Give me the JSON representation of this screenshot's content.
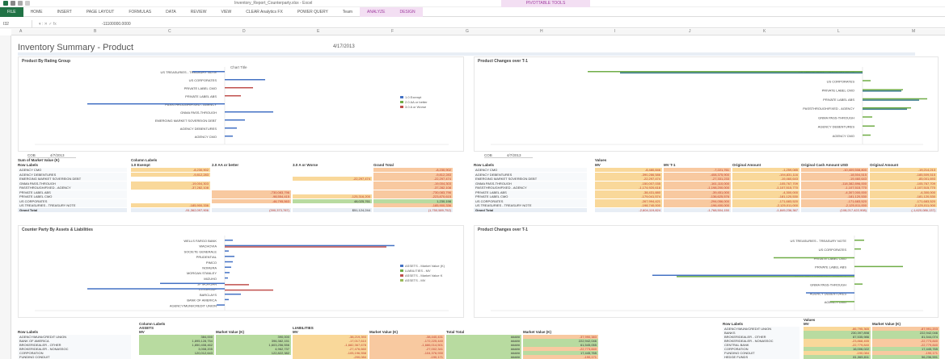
{
  "window": {
    "title": "Inventory_Report_Counterparty.xlsx - Excel",
    "context_title": "PIVOTTABLE TOOLS"
  },
  "ribbon": {
    "tabs": [
      "FILE",
      "HOME",
      "INSERT",
      "PAGE LAYOUT",
      "FORMULAS",
      "DATA",
      "REVIEW",
      "VIEW",
      "CLEAR Analytics FX",
      "POWER QUERY",
      "Team",
      "ANALYZE",
      "DESIGN"
    ],
    "context_tabs": [
      "ANALYZE",
      "DESIGN"
    ]
  },
  "formula_bar": {
    "name_box": "I32",
    "value": "-11100000.0000"
  },
  "columns": [
    "A",
    "B",
    "C",
    "D",
    "E",
    "F",
    "G",
    "H",
    "I",
    "J",
    "K",
    "L",
    "M"
  ],
  "sheet": {
    "title": "Inventory Summary - Product",
    "date": "4/17/2013"
  },
  "charts": {
    "top_left": {
      "title": "Product By Rating Group",
      "chart_title": "Chart Title",
      "categories": [
        "US TREASURIES - TREASURY NOTE",
        "US CORPORATES",
        "PRIVATE LABEL CMO",
        "PRIVATE LABEL ABS",
        "PASSTHROUGH/FIXED - AGENCY",
        "GNMA PASS-THROUGH",
        "EMERGING MARKET SOVEREIGN DEBT",
        "AGENCY DEBENTURES",
        "AGENCY CMO"
      ],
      "legend": [
        "1.0 Exempt",
        "2.0 AA or better",
        "3.0 A or Worse"
      ],
      "filter_value": "COB",
      "filter_date": "4/7/2013"
    },
    "top_right": {
      "title": "Product Changes over T-1",
      "categories": [
        "US TREASURIES - TREASURY NOTE",
        "US CORPORATES",
        "PRIVATE LABEL CMO",
        "PRIVATE LABEL ABS",
        "PASSTHROUGH/FIXED - AGENCY",
        "GNMA PASS-THROUGH",
        "AGENCY DEBENTURES",
        "AGENCY CMO"
      ],
      "filter_value": "COB",
      "filter_date": "4/7/2013"
    },
    "bottom_left": {
      "title": "Counter Party By Assets & Liabilities",
      "categories": [
        "WELLS FARGO BANK",
        "WACHOVIA",
        "SOCIETE GENERALE",
        "PRUDENTIAL",
        "PIMCO",
        "NOMURA",
        "MORGAN STANLEY",
        "MIZUHO",
        "JP MORGAN",
        "CITIGROUP",
        "BARCLAYS",
        "BANK OF AMERICA",
        "AGENCY/MUNI/CREDIT UNION"
      ],
      "legend": [
        "ASSETS - Market Value (K)",
        "LIABILITIES - MV",
        "ASSETS - Market Value K",
        "ASSETS - MV"
      ]
    },
    "bottom_right": {
      "title": "Product Changes over T-1",
      "categories": [
        "US TREASURIES - TREASURY NOTE",
        "US CORPORATES",
        "PRIVATE LABEL CMO",
        "PRIVATE LABEL ABS",
        "PASSTHROUGH/FIXED - AGENCY",
        "GNMA PASS-THROUGH",
        "AGENCY DEBENTURES",
        "AGENCY CMO"
      ]
    }
  },
  "pivot_left": {
    "header_sum": "Sum of Market Value (K)",
    "header_cols": "Column Labels",
    "row_labels": "Row Labels",
    "col_headers": [
      "1.0 Exempt",
      "2.0 AA or better",
      "3.0 A or Worse",
      "Grand Total"
    ],
    "rows": [
      {
        "label": "AGENCY CMO",
        "v": [
          "-8,230,902",
          "",
          "",
          "-8,230,902"
        ]
      },
      {
        "label": "AGENCY DEBENTURES",
        "v": [
          "-9,812,283",
          "",
          "",
          "-9,812,283"
        ]
      },
      {
        "label": "EMERGING MARKET SOVEREIGN DEBT",
        "v": [
          "",
          "",
          "-22,297,474",
          "-22,297,474"
        ]
      },
      {
        "label": "GNMA PASS-THROUGH",
        "v": [
          "-19,004,303",
          "",
          "",
          "-19,004,303"
        ]
      },
      {
        "label": "PASSTHROUGH/FIXED - AGENCY",
        "v": [
          "-37,282,108",
          "",
          "",
          "-37,282,108"
        ]
      },
      {
        "label": "PRIVATE LABEL ABS",
        "v": [
          "",
          "-730,083,796",
          "",
          "-730,083,796"
        ]
      },
      {
        "label": "PRIVATE LABEL CMO",
        "v": [
          "",
          "-98,554,415",
          "-125,316,200",
          "-223,870,615"
        ]
      },
      {
        "label": "US CORPORATES",
        "v": [
          "",
          "-46,795,563",
          "48,025,761",
          "1,230,198"
        ]
      },
      {
        "label": "US TREASURIES - TREASURY NOTE",
        "v": [
          "-185,900,336",
          "",
          "",
          "-185,900,336"
        ]
      },
      {
        "label": "Grand Total",
        "v": [
          "-91,362,097,906",
          "(390,373,787)",
          "$51,124,244",
          "(1,750,589,752)"
        ]
      }
    ]
  },
  "pivot_right": {
    "values_label": "Values",
    "row_labels": "Row Labels",
    "col_headers": [
      "MV",
      "MV T-1",
      "Original Amount",
      "Original Cash Amount USD",
      "Original Amount"
    ],
    "rows": [
      {
        "label": "AGENCY CMO",
        "v": [
          "-8,480,846",
          "-7,221,761",
          "-1,259,085",
          "-10,409,508,800",
          "-19,214,213"
        ]
      },
      {
        "label": "AGENCY DEBENTURES",
        "v": [
          "-390,286,586",
          "-408,375,900",
          "-194,831,116",
          "-18,504,515",
          "-185,509,515"
        ]
      },
      {
        "label": "EMERGING MARKET SOVEREIGN DEBT",
        "v": [
          "-22,297,474",
          "-27,331,233",
          "-19,460,643",
          "-19,460,643",
          "-85,001,693"
        ]
      },
      {
        "label": "GNMA PASS-THROUGH",
        "v": [
          "-150,007,035",
          "-161,110,000",
          "-105,767,709",
          "-118,382,896,000",
          "-105,767,709"
        ]
      },
      {
        "label": "PASSTHROUGH/FIXED - AGENCY",
        "v": [
          "-1,174,920,618",
          "-1,198,200,000",
          "-1,107,515,770",
          "-1,107,515,770",
          "-1,107,515,770"
        ]
      },
      {
        "label": "PRIVATE LABEL ABS",
        "v": [
          "-38,431,880",
          "-39,451,000",
          "-4,300,000",
          "-4,307,000,000",
          "-4,300,000"
        ]
      },
      {
        "label": "PRIVATE LABEL CMO",
        "v": [
          "-179,041,574",
          "-136,625,576",
          "-181,120,530",
          "-181,120,530",
          "-181,120,530"
        ]
      },
      {
        "label": "US CORPORATES",
        "v": [
          "-267,994,421",
          "-294,056,000",
          "-171,683,520",
          "-171,683,520",
          "-171,683,520"
        ]
      },
      {
        "label": "US TREASURIES - TREASURY NOTE",
        "v": [
          "-198,740,000",
          "-196,400,000",
          "-2,125,011,000",
          "-2,125,011,000",
          "-2,125,011,000"
        ]
      },
      {
        "label": "Grand Total",
        "v": [
          "-2,604,119,824",
          "-1,768,504,150",
          "-1,849,236,367",
          "(108,217,422,908)",
          "(-1,620,086,137)"
        ]
      }
    ]
  },
  "pivot_bottom_left": {
    "header_cols": "Column Labels",
    "row_labels": "Row Labels",
    "groups": [
      "ASSETS",
      "LIABILITIES"
    ],
    "col_headers": [
      "MV",
      "Market Value (K)",
      "MV",
      "Market Value (K)",
      "Total Total",
      "Market Value (K)"
    ],
    "rows": [
      {
        "label": "AGENCY/MUNI/CREDIT UNION",
        "v": [
          "384,000",
          "390,000",
          "-38,219,393",
          "-38,440,431",
          "#####",
          "-37,990,383"
        ]
      },
      {
        "label": "BANK OF AMERICA",
        "v": [
          "1,895,128,754",
          "396,382,151",
          "-17,017,610",
          "-172,225,440",
          "#####",
          "222,942,046"
        ]
      },
      {
        "label": "BROKER/DEALER - OTHER",
        "v": [
          "1,850,408,462",
          "1,603,256,556",
          "-1,682,367,678",
          "-1,686,014,501",
          "#####",
          "61,545,055"
        ]
      },
      {
        "label": "BROKER/DEALER - NONASSOC",
        "v": [
          "3,008,205",
          "4,962,737",
          "-27,476,660",
          "-27,002,341",
          "#####",
          "-22,773,840"
        ]
      },
      {
        "label": "CORPORATION",
        "v": [
          "120,012,643",
          "122,822,382",
          "-105,196,558",
          "-104,376,930",
          "#####",
          "17,445,765"
        ]
      },
      {
        "label": "FUNDING CONDUIT",
        "v": [
          "",
          "",
          "-200,084",
          "-190,171",
          "#####",
          "-190,171"
        ]
      }
    ]
  },
  "pivot_bottom_right": {
    "values_label": "Values",
    "row_labels": "Row Labels",
    "col_headers": [
      "MV",
      "Market Value (K)"
    ],
    "rows": [
      {
        "label": "AGENCY/MUNI/CREDIT UNION",
        "v": [
          "-86,795,365",
          "-87,991,203"
        ]
      },
      {
        "label": "BANKS",
        "v": [
          "230,397,898",
          "222,942,046"
        ]
      },
      {
        "label": "BROKER/DEALER - OTHER",
        "v": [
          "87,535,986",
          "81,544,074"
        ]
      },
      {
        "label": "BROKER/DEALER - NONASSOC",
        "v": [
          "-23,868,455",
          "-22,773,840"
        ]
      },
      {
        "label": "CENTRAL BANK",
        "v": [
          "-22,779,840",
          "-22,779,840"
        ]
      },
      {
        "label": "CORPORATION",
        "v": [
          "16,006,022",
          "17,445,765"
        ]
      },
      {
        "label": "FUNDING CONDUIT",
        "v": [
          "-190,084",
          "-190,171"
        ]
      },
      {
        "label": "HEDGE FUNDS",
        "v": [
          "81,065,811",
          "56,236,591"
        ]
      }
    ]
  }
}
